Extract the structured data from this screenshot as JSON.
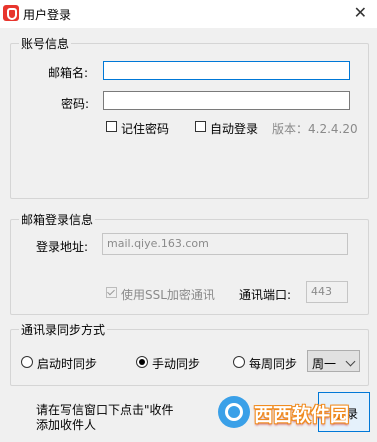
{
  "window": {
    "title": "用户登录",
    "close_glyph": "✕"
  },
  "account": {
    "group_title": "账号信息",
    "email_label": "邮箱名:",
    "email_value": "",
    "password_label": "密码:",
    "password_value": "",
    "remember_label": "记住密码",
    "auto_login_label": "自动登录",
    "version_text": "版本：4.2.4.20"
  },
  "mail_login": {
    "group_title": "邮箱登录信息",
    "address_label": "登录地址:",
    "address_value": "mail.qiye.163.com",
    "ssl_label": "使用SSL加密通讯",
    "port_label": "通讯端口:",
    "port_value": "443"
  },
  "sync": {
    "group_title": "通讯录同步方式",
    "options": [
      "启动时同步",
      "手动同步",
      "每周同步"
    ],
    "selected": "手动同步",
    "weekday_value": "周一"
  },
  "footer": {
    "hint": "请在写信窗口下点击\"收件人\"下的\"+\"添加收件人",
    "hint_line1": "请在写信窗口下点击\"收件",
    "hint_line2": "添加收件人",
    "login_label": "登录"
  },
  "watermark": {
    "text": "西西软件园"
  }
}
